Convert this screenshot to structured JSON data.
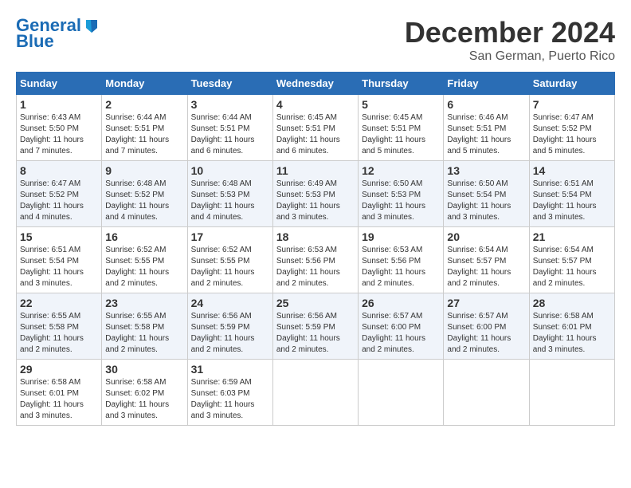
{
  "logo": {
    "line1": "General",
    "line2": "Blue"
  },
  "header": {
    "month": "December 2024",
    "location": "San German, Puerto Rico"
  },
  "days_of_week": [
    "Sunday",
    "Monday",
    "Tuesday",
    "Wednesday",
    "Thursday",
    "Friday",
    "Saturday"
  ],
  "weeks": [
    [
      {
        "day": "1",
        "sunrise": "6:43 AM",
        "sunset": "5:50 PM",
        "daylight": "11 hours and 7 minutes."
      },
      {
        "day": "2",
        "sunrise": "6:44 AM",
        "sunset": "5:51 PM",
        "daylight": "11 hours and 7 minutes."
      },
      {
        "day": "3",
        "sunrise": "6:44 AM",
        "sunset": "5:51 PM",
        "daylight": "11 hours and 6 minutes."
      },
      {
        "day": "4",
        "sunrise": "6:45 AM",
        "sunset": "5:51 PM",
        "daylight": "11 hours and 6 minutes."
      },
      {
        "day": "5",
        "sunrise": "6:45 AM",
        "sunset": "5:51 PM",
        "daylight": "11 hours and 5 minutes."
      },
      {
        "day": "6",
        "sunrise": "6:46 AM",
        "sunset": "5:51 PM",
        "daylight": "11 hours and 5 minutes."
      },
      {
        "day": "7",
        "sunrise": "6:47 AM",
        "sunset": "5:52 PM",
        "daylight": "11 hours and 5 minutes."
      }
    ],
    [
      {
        "day": "8",
        "sunrise": "6:47 AM",
        "sunset": "5:52 PM",
        "daylight": "11 hours and 4 minutes."
      },
      {
        "day": "9",
        "sunrise": "6:48 AM",
        "sunset": "5:52 PM",
        "daylight": "11 hours and 4 minutes."
      },
      {
        "day": "10",
        "sunrise": "6:48 AM",
        "sunset": "5:53 PM",
        "daylight": "11 hours and 4 minutes."
      },
      {
        "day": "11",
        "sunrise": "6:49 AM",
        "sunset": "5:53 PM",
        "daylight": "11 hours and 3 minutes."
      },
      {
        "day": "12",
        "sunrise": "6:50 AM",
        "sunset": "5:53 PM",
        "daylight": "11 hours and 3 minutes."
      },
      {
        "day": "13",
        "sunrise": "6:50 AM",
        "sunset": "5:54 PM",
        "daylight": "11 hours and 3 minutes."
      },
      {
        "day": "14",
        "sunrise": "6:51 AM",
        "sunset": "5:54 PM",
        "daylight": "11 hours and 3 minutes."
      }
    ],
    [
      {
        "day": "15",
        "sunrise": "6:51 AM",
        "sunset": "5:54 PM",
        "daylight": "11 hours and 3 minutes."
      },
      {
        "day": "16",
        "sunrise": "6:52 AM",
        "sunset": "5:55 PM",
        "daylight": "11 hours and 2 minutes."
      },
      {
        "day": "17",
        "sunrise": "6:52 AM",
        "sunset": "5:55 PM",
        "daylight": "11 hours and 2 minutes."
      },
      {
        "day": "18",
        "sunrise": "6:53 AM",
        "sunset": "5:56 PM",
        "daylight": "11 hours and 2 minutes."
      },
      {
        "day": "19",
        "sunrise": "6:53 AM",
        "sunset": "5:56 PM",
        "daylight": "11 hours and 2 minutes."
      },
      {
        "day": "20",
        "sunrise": "6:54 AM",
        "sunset": "5:57 PM",
        "daylight": "11 hours and 2 minutes."
      },
      {
        "day": "21",
        "sunrise": "6:54 AM",
        "sunset": "5:57 PM",
        "daylight": "11 hours and 2 minutes."
      }
    ],
    [
      {
        "day": "22",
        "sunrise": "6:55 AM",
        "sunset": "5:58 PM",
        "daylight": "11 hours and 2 minutes."
      },
      {
        "day": "23",
        "sunrise": "6:55 AM",
        "sunset": "5:58 PM",
        "daylight": "11 hours and 2 minutes."
      },
      {
        "day": "24",
        "sunrise": "6:56 AM",
        "sunset": "5:59 PM",
        "daylight": "11 hours and 2 minutes."
      },
      {
        "day": "25",
        "sunrise": "6:56 AM",
        "sunset": "5:59 PM",
        "daylight": "11 hours and 2 minutes."
      },
      {
        "day": "26",
        "sunrise": "6:57 AM",
        "sunset": "6:00 PM",
        "daylight": "11 hours and 2 minutes."
      },
      {
        "day": "27",
        "sunrise": "6:57 AM",
        "sunset": "6:00 PM",
        "daylight": "11 hours and 2 minutes."
      },
      {
        "day": "28",
        "sunrise": "6:58 AM",
        "sunset": "6:01 PM",
        "daylight": "11 hours and 3 minutes."
      }
    ],
    [
      {
        "day": "29",
        "sunrise": "6:58 AM",
        "sunset": "6:01 PM",
        "daylight": "11 hours and 3 minutes."
      },
      {
        "day": "30",
        "sunrise": "6:58 AM",
        "sunset": "6:02 PM",
        "daylight": "11 hours and 3 minutes."
      },
      {
        "day": "31",
        "sunrise": "6:59 AM",
        "sunset": "6:03 PM",
        "daylight": "11 hours and 3 minutes."
      },
      null,
      null,
      null,
      null
    ]
  ],
  "labels": {
    "sunrise": "Sunrise:",
    "sunset": "Sunset:",
    "daylight": "Daylight:"
  }
}
